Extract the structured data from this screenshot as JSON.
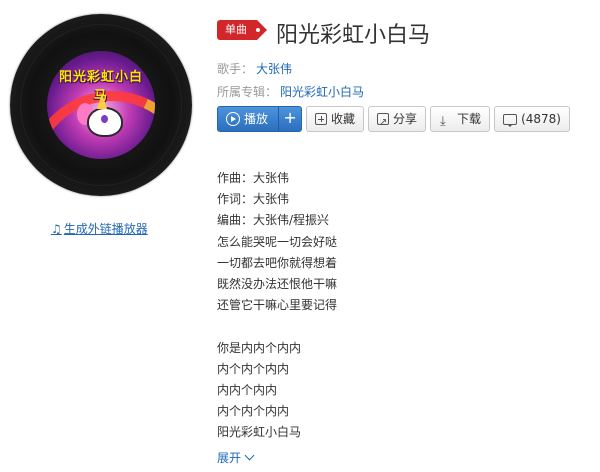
{
  "cover": {
    "art_text": "阳光彩虹小白马"
  },
  "player_link": {
    "icon": "music-note-icon",
    "label": "生成外链播放器"
  },
  "badge": "单曲",
  "title": "阳光彩虹小白马",
  "meta": {
    "singer_label": "歌手：",
    "singer": "大张伟",
    "album_label": "所属专辑：",
    "album": "阳光彩虹小白马"
  },
  "buttons": {
    "play": "播放",
    "plus": "+",
    "collect": "收藏",
    "share": "分享",
    "download": "下载",
    "comments": "(4878)"
  },
  "lyrics": {
    "block1": [
      "作曲：大张伟",
      "作词：大张伟",
      "编曲：大张伟/程振兴",
      "怎么能哭呢一切会好哒",
      "一切都去吧你就得想着",
      "既然没办法还恨他干嘛",
      "还管它干嘛心里要记得"
    ],
    "block2": [
      "你是内内个内内",
      "内个内个内内",
      "内内个内内",
      "内个内个内内",
      "阳光彩虹小白马"
    ]
  },
  "expand_label": "展开"
}
